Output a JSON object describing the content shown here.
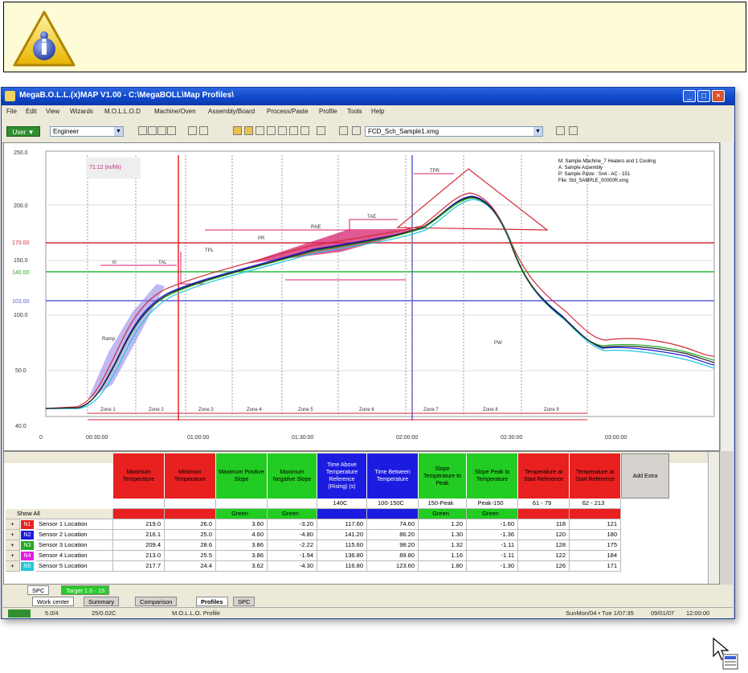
{
  "note": {
    "icon": "information-icon"
  },
  "window": {
    "title": "MegaB.O.L.L.(x)MAP V1.00 - C:\\MegaBOLL\\Map Profiles\\",
    "menu": [
      "File",
      "Edit",
      "View",
      "Wizards",
      "M.O.L.L.O.D",
      "Machine/Oven",
      "Assembly/Board",
      "Process/Paste",
      "Profile",
      "Tools",
      "Help"
    ],
    "toolbar": {
      "user_button": "User ▼",
      "mode_value": "Engineer",
      "file_value": "FCD_Sch_Sample1.xmg"
    }
  },
  "chart": {
    "y_ticks": [
      "250.0",
      "200.0",
      "170.00",
      "150.0",
      "140.00",
      "103.00",
      "100.0",
      "50.0",
      "40.0"
    ],
    "x_ticks": [
      "0",
      "00:30:00",
      "01:00:00",
      "01:30:00",
      "02:00:00",
      "02:30:00",
      "03:00:00"
    ],
    "cursor_time": "71:12 (m/hh)",
    "info": [
      "M: Sample Machine_7 Heaters and 1 Cooling",
      "A: Sample Assembly",
      "P: Sample Paste : Sn4 - AC - 151",
      "File: Std_SAMPLE_00000R.xmg"
    ],
    "zones": [
      "Zone 1",
      "Zone 2",
      "Zone 3",
      "Zone 4",
      "Zone 5",
      "Zone 6",
      "Zone 7",
      "Zone 8",
      "Zone 9"
    ],
    "annotations": [
      "Ramp",
      "t/l",
      "TAL",
      "RNE",
      "TAE",
      "PR",
      "PW",
      "TPR",
      "TPL"
    ],
    "colors": {
      "limit_red": "#d42a3a",
      "limit_green": "#5ccc6a",
      "limit_blue": "#5a5fd6",
      "envelope": "#d6226e",
      "window": "#6b5bd6"
    }
  },
  "table": {
    "headers": [
      {
        "label": "Maximum Temperature",
        "color": "#e82020"
      },
      {
        "label": "Minimum Temperature",
        "color": "#e82020"
      },
      {
        "label": "Maximum Positive Slope",
        "color": "#22cc22"
      },
      {
        "label": "Maximum Negative Slope",
        "color": "#22cc22"
      },
      {
        "label": "Time Above Temperature Reference (Rising) (s)",
        "color": "#1c1ce0"
      },
      {
        "label": "Time Between Temperature",
        "color": "#1c1ce0"
      },
      {
        "label": "Slope Temperature to Peak",
        "color": "#22cc22"
      },
      {
        "label": "Slope Peak to Temperature",
        "color": "#22cc22"
      },
      {
        "label": "Temperature at Start Reference",
        "color": "#e82020"
      },
      {
        "label": "Temperature at Start Reference",
        "color": "#e82020"
      },
      {
        "label": "Add Extra",
        "color": "#d6d3ce"
      }
    ],
    "limits": [
      "",
      "",
      "",
      "",
      "140C",
      "100-150C",
      "150-Peak",
      "Peak-150",
      "61 - 79",
      "62 - 213",
      ""
    ],
    "status": [
      {
        "text": "",
        "color": "#e82020"
      },
      {
        "text": "",
        "color": "#e82020"
      },
      {
        "text": "Green",
        "color": "#22cc22"
      },
      {
        "text": "Green",
        "color": "#22cc22"
      },
      {
        "text": "",
        "color": "#1c1ce0"
      },
      {
        "text": "",
        "color": "#1c1ce0"
      },
      {
        "text": "Green",
        "color": "#22cc22"
      },
      {
        "text": "Green",
        "color": "#22cc22"
      },
      {
        "text": "",
        "color": "#e82020"
      },
      {
        "text": "",
        "color": "#e82020"
      },
      {
        "text": "",
        "color": "#d6d3ce"
      }
    ],
    "group_label": "Show All",
    "rows": [
      {
        "chip": "N1",
        "chip_color": "#e82020",
        "name": "Sensor 1 Location",
        "values": [
          "219.0",
          "26.0",
          "3.60",
          "-3.20",
          "117.60",
          "74.60",
          "1.20",
          "-1.60",
          "118",
          "121"
        ]
      },
      {
        "chip": "N2",
        "chip_color": "#1c1ce0",
        "name": "Sensor 2 Location",
        "values": [
          "216.1",
          "25.0",
          "4.60",
          "-4.80",
          "141.20",
          "86.20",
          "1.30",
          "-1.36",
          "120",
          "180"
        ]
      },
      {
        "chip": "N3",
        "chip_color": "#22aa22",
        "name": "Sensor 3 Location",
        "values": [
          "209.4",
          "28.6",
          "3.86",
          "-2.22",
          "115.60",
          "98.20",
          "1.32",
          "-1.11",
          "128",
          "175"
        ]
      },
      {
        "chip": "N4",
        "chip_color": "#e020e0",
        "name": "Sensor 4 Location",
        "values": [
          "213.0",
          "25.5",
          "3.86",
          "-1.94",
          "136.80",
          "89.80",
          "1.16",
          "-1.11",
          "122",
          "184"
        ]
      },
      {
        "chip": "N5",
        "chip_color": "#20c8d8",
        "name": "Sensor 5 Location",
        "values": [
          "217.7",
          "24.4",
          "3.62",
          "-4.30",
          "116.80",
          "123.60",
          "1.80",
          "-1.30",
          "126",
          "171"
        ]
      }
    ]
  },
  "tabs_row1": [
    "SPC",
    "Target 1.0 - 15"
  ],
  "tabs_row2": [
    "Work center",
    "Summary",
    "Comparison",
    "Profiles",
    "SPC"
  ],
  "status": [
    "5.0/4",
    "25/0.02C",
    "M.O.L.L.O. Profile",
    "SunMon/04 • Tue 1/07:35",
    "09/01/07",
    "12:00:00"
  ]
}
